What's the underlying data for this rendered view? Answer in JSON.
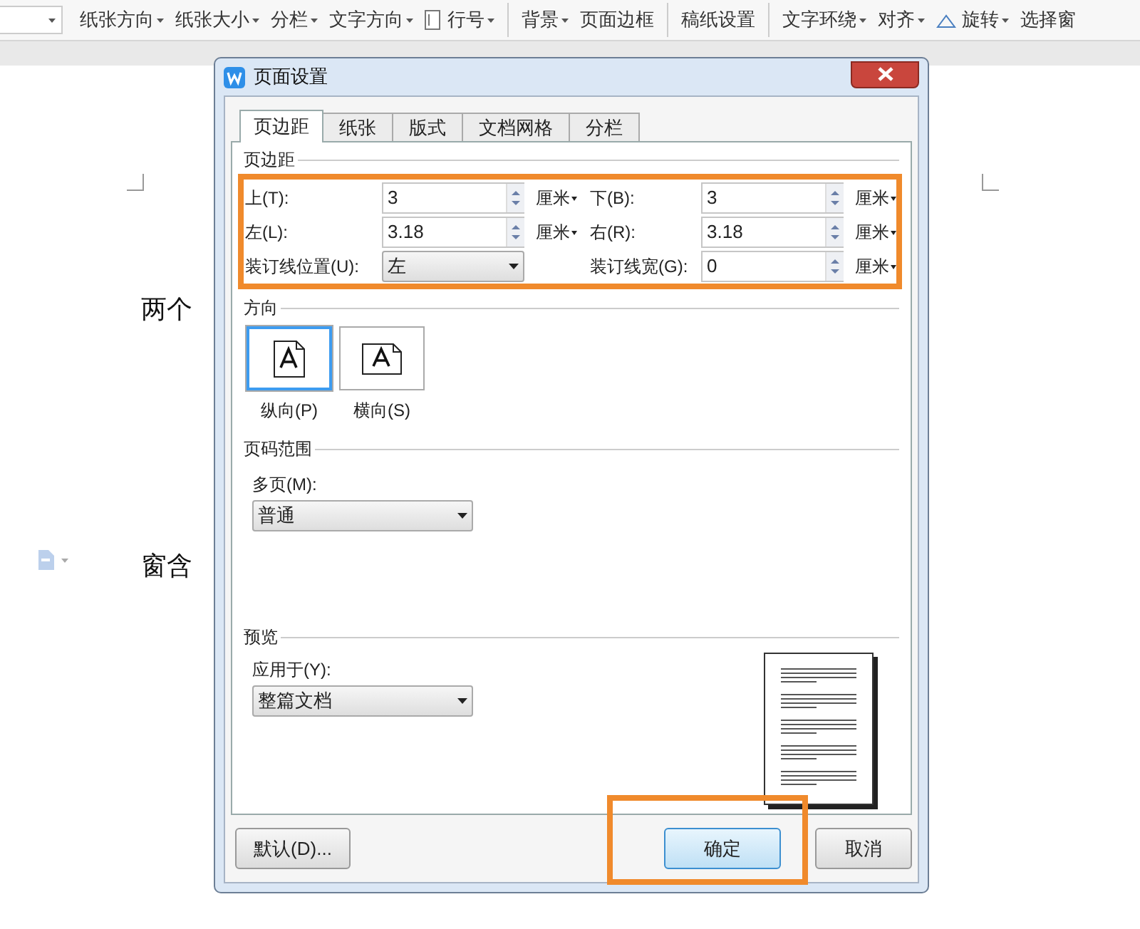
{
  "toolbar": {
    "items": [
      {
        "label": "纸张方向",
        "dropdown": true
      },
      {
        "label": "纸张大小",
        "dropdown": true
      },
      {
        "label": "分栏",
        "dropdown": true
      },
      {
        "label": "文字方向",
        "dropdown": true
      },
      {
        "label": "行号",
        "dropdown": true,
        "kind": "line-number"
      },
      {
        "label": "背景",
        "dropdown": true,
        "separator": true
      },
      {
        "label": "页面边框",
        "dropdown": false
      },
      {
        "label": "稿纸设置",
        "dropdown": false,
        "separator": true
      },
      {
        "label": "文字环绕",
        "dropdown": true,
        "separator": true
      },
      {
        "label": "对齐",
        "dropdown": true
      },
      {
        "label": "旋转",
        "dropdown": true,
        "kind": "rotate"
      },
      {
        "label": "选择窗",
        "dropdown": false
      }
    ]
  },
  "document": {
    "lines": [
      "两个",
      "窗含"
    ]
  },
  "dialog": {
    "title": "页面设置",
    "tabs": [
      {
        "label": "页边距",
        "selected": true
      },
      {
        "label": "纸张",
        "selected": false
      },
      {
        "label": "版式",
        "selected": false
      },
      {
        "label": "文档网格",
        "selected": false
      },
      {
        "label": "分栏",
        "selected": false
      }
    ],
    "margins": {
      "title": "页边距",
      "highlighted": true,
      "fields": [
        {
          "label": "上(T):",
          "value": "3",
          "unit": "厘米",
          "kind": "spin"
        },
        {
          "label": "下(B):",
          "value": "3",
          "unit": "厘米",
          "kind": "spin"
        },
        {
          "label": "左(L):",
          "value": "3.18",
          "unit": "厘米",
          "kind": "spin"
        },
        {
          "label": "右(R):",
          "value": "3.18",
          "unit": "厘米",
          "kind": "spin"
        },
        {
          "label": "装订线位置(U):",
          "value": "左",
          "kind": "select"
        },
        {
          "label": "装订线宽(G):",
          "value": "0",
          "unit": "厘米",
          "kind": "spin"
        }
      ]
    },
    "orientation": {
      "title": "方向",
      "options": [
        {
          "label": "纵向(P)",
          "kind": "portrait",
          "selected": true
        },
        {
          "label": "横向(S)",
          "kind": "landscape",
          "selected": false
        }
      ]
    },
    "page_range": {
      "title": "页码范围",
      "label": "多页(M):",
      "value": "普通"
    },
    "preview": {
      "title": "预览",
      "label": "应用于(Y):",
      "value": "整篇文档"
    },
    "buttons": [
      {
        "label": "默认(D)...",
        "kind": "default",
        "highlighted": false
      },
      {
        "label": "确定",
        "kind": "primary",
        "highlighted": true
      },
      {
        "label": "取消",
        "kind": "normal",
        "highlighted": false
      }
    ]
  }
}
